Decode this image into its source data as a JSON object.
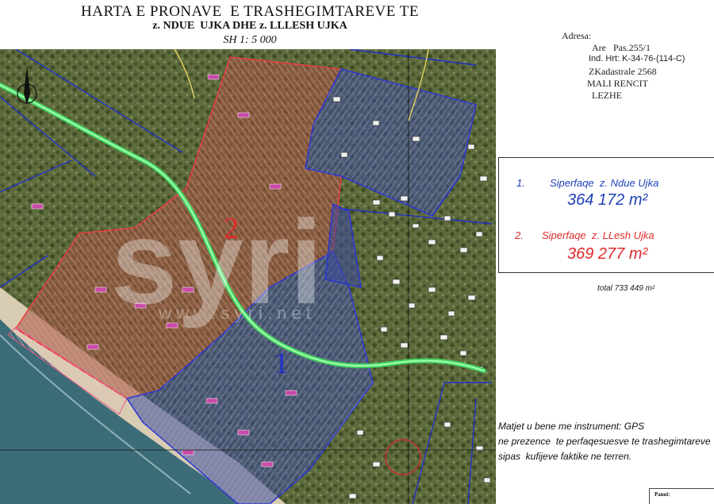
{
  "header": {
    "title": "HARTA E PRONAVE  E TRASHEGIMTAREVE TE",
    "subtitle": "z. NDUE  UJKA DHE z. LLLESH UJKA",
    "scale": "SH 1: 5 000"
  },
  "address": {
    "label": "Adresa:",
    "line1": "Are   Pas.255/1",
    "line2": "Ind. Hrt: K-34-76-(114-C)",
    "line3": "ZKadastrale 2568",
    "line4": "MALI RENCIT",
    "line5": "LEZHE"
  },
  "legend": {
    "items": [
      {
        "number": "1.",
        "label": "Siperfaqe  z. Ndue Ujka",
        "area": "364 172 m²",
        "color": "#1f3fb8"
      },
      {
        "number": "2.",
        "label": "Siperfaqe  z. LLesh Ujka",
        "area": "369 277 m²",
        "color": "#e02a2a"
      }
    ],
    "total": "total 733 449 m²"
  },
  "map": {
    "parcel_labels": [
      "1",
      "2"
    ],
    "watermark": "syri",
    "watermark_url": "w w w . s y r i . n e t",
    "colors": {
      "parcel_1": "#2b3fae",
      "parcel_2": "#d93a3a",
      "road": "#5cf07c",
      "sea": "#3c6a78",
      "beach": "#d9cdb5"
    }
  },
  "notes": {
    "line1": "Matjet u bene me instrument: GPS",
    "line2": "ne prezence  te perfaqesuesve te trashegimtareve",
    "line3": "sipas  kufijeve faktike ne terren."
  },
  "panoi_label": "Panoi:"
}
